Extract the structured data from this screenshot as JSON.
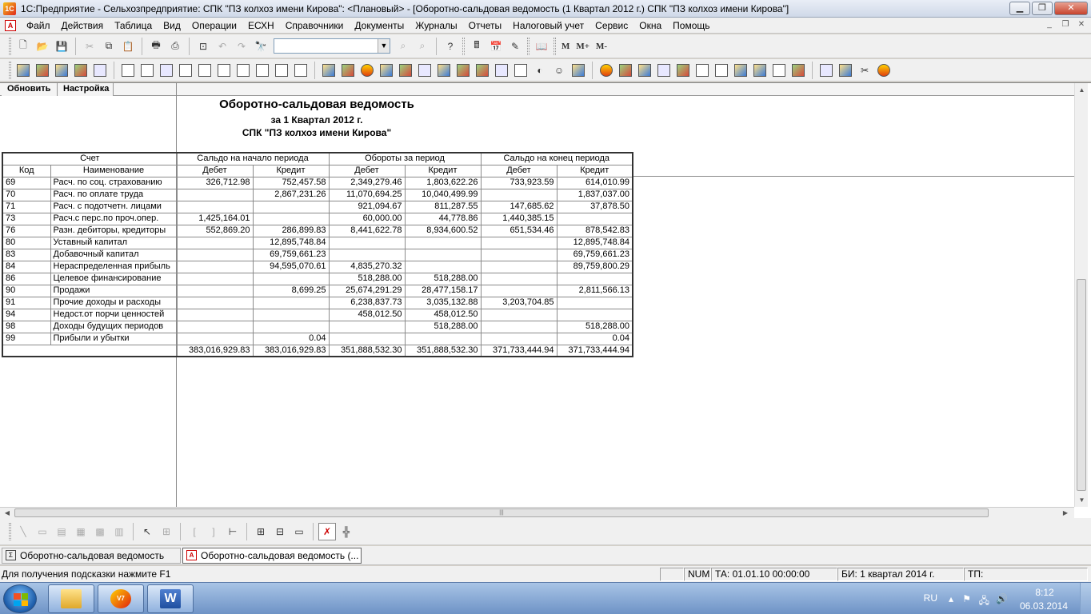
{
  "window": {
    "title": "1С:Предприятие - Сельхозпредприятие: СПК \"ПЗ колхоз имени Кирова\": <Плановый> - [Оборотно-сальдовая ведомость (1 Квартал 2012 г.) СПК \"ПЗ колхоз имени Кирова\"]",
    "minimize": "▁",
    "restore": "❐",
    "close": "✕"
  },
  "menu": {
    "items": [
      "Файл",
      "Действия",
      "Таблица",
      "Вид",
      "Операции",
      "ЕСХН",
      "Справочники",
      "Документы",
      "Журналы",
      "Отчеты",
      "Налоговый учет",
      "Сервис",
      "Окна",
      "Помощь"
    ],
    "mdi_minimize": "_",
    "mdi_restore": "❐",
    "mdi_close": "✕"
  },
  "toolbar": {
    "combo_value": "",
    "combo_arrow": "▼",
    "m_label": "M",
    "m_plus_label": "M+",
    "m_minus_label": "M-",
    "help": "?"
  },
  "report": {
    "refresh_label": "Обновить",
    "settings_label": "Настройка",
    "title": "Оборотно-сальдовая ведомость",
    "period": "за 1 Квартал 2012 г.",
    "org": "СПК \"ПЗ колхоз имени Кирова\"",
    "header": {
      "account": "Счет",
      "opening": "Сальдо на начало периода",
      "turnover": "Обороты за период",
      "closing": "Сальдо на конец периода",
      "code": "Код",
      "name": "Наименование",
      "debit": "Дебет",
      "credit": "Кредит"
    },
    "rows": [
      {
        "code": "69",
        "name": "Расч. по соц. страхованию",
        "od": "326,712.98",
        "oc": "752,457.58",
        "td": "2,349,279.46",
        "tc": "1,803,622.26",
        "cd": "733,923.59",
        "cc": "614,010.99"
      },
      {
        "code": "70",
        "name": "Расч. по оплате труда",
        "od": "",
        "oc": "2,867,231.26",
        "td": "11,070,694.25",
        "tc": "10,040,499.99",
        "cd": "",
        "cc": "1,837,037.00"
      },
      {
        "code": "71",
        "name": "Расч. с подотчетн. лицами",
        "od": "",
        "oc": "",
        "td": "921,094.67",
        "tc": "811,287.55",
        "cd": "147,685.62",
        "cc": "37,878.50"
      },
      {
        "code": "73",
        "name": "Расч.с перс.по проч.опер.",
        "od": "1,425,164.01",
        "oc": "",
        "td": "60,000.00",
        "tc": "44,778.86",
        "cd": "1,440,385.15",
        "cc": ""
      },
      {
        "code": "76",
        "name": "Разн. дебиторы, кредиторы",
        "od": "552,869.20",
        "oc": "286,899.83",
        "td": "8,441,622.78",
        "tc": "8,934,600.52",
        "cd": "651,534.46",
        "cc": "878,542.83"
      },
      {
        "code": "80",
        "name": "Уставный капитал",
        "od": "",
        "oc": "12,895,748.84",
        "td": "",
        "tc": "",
        "cd": "",
        "cc": "12,895,748.84"
      },
      {
        "code": "83",
        "name": "Добавочный капитал",
        "od": "",
        "oc": "69,759,661.23",
        "td": "",
        "tc": "",
        "cd": "",
        "cc": "69,759,661.23"
      },
      {
        "code": "84",
        "name": "Нераспределенная прибыль",
        "od": "",
        "oc": "94,595,070.61",
        "td": "4,835,270.32",
        "tc": "",
        "cd": "",
        "cc": "89,759,800.29"
      },
      {
        "code": "86",
        "name": "Целевое финансирование",
        "od": "",
        "oc": "",
        "td": "518,288.00",
        "tc": "518,288.00",
        "cd": "",
        "cc": ""
      },
      {
        "code": "90",
        "name": "Продажи",
        "od": "",
        "oc": "8,699.25",
        "td": "25,674,291.29",
        "tc": "28,477,158.17",
        "cd": "",
        "cc": "2,811,566.13"
      },
      {
        "code": "91",
        "name": "Прочие доходы и расходы",
        "od": "",
        "oc": "",
        "td": "6,238,837.73",
        "tc": "3,035,132.88",
        "cd": "3,203,704.85",
        "cc": ""
      },
      {
        "code": "94",
        "name": "Недост.от порчи ценностей",
        "od": "",
        "oc": "",
        "td": "458,012.50",
        "tc": "458,012.50",
        "cd": "",
        "cc": ""
      },
      {
        "code": "98",
        "name": "Доходы будущих периодов",
        "od": "",
        "oc": "",
        "td": "",
        "tc": "518,288.00",
        "cd": "",
        "cc": "518,288.00"
      },
      {
        "code": "99",
        "name": "Прибыли и убытки",
        "od": "",
        "oc": "0.04",
        "td": "",
        "tc": "",
        "cd": "",
        "cc": "0.04"
      }
    ],
    "totals": {
      "od": "383,016,929.83",
      "oc": "383,016,929.83",
      "td": "351,888,532.30",
      "tc": "351,888,532.30",
      "cd": "371,733,444.94",
      "cc": "371,733,444.94"
    }
  },
  "window_tabs": [
    {
      "label": "Оборотно-сальдовая ведомость",
      "icon": "Σ"
    },
    {
      "label": "Оборотно-сальдовая ведомость (...",
      "icon": "A"
    }
  ],
  "status": {
    "hint": "Для получения подсказки нажмите F1",
    "num": "NUM",
    "ta": "ТА: 01.01.10  00:00:00",
    "bi": "БИ: 1 квартал 2014 г.",
    "tp": "ТП:"
  },
  "taskbar": {
    "lang": "RU",
    "time": "8:12",
    "date": "06.03.2014",
    "app_1c_label": "V7",
    "word_label": "W"
  },
  "colors": {
    "accent_red": "#cc0000",
    "taskbar": "#6e93c6"
  }
}
